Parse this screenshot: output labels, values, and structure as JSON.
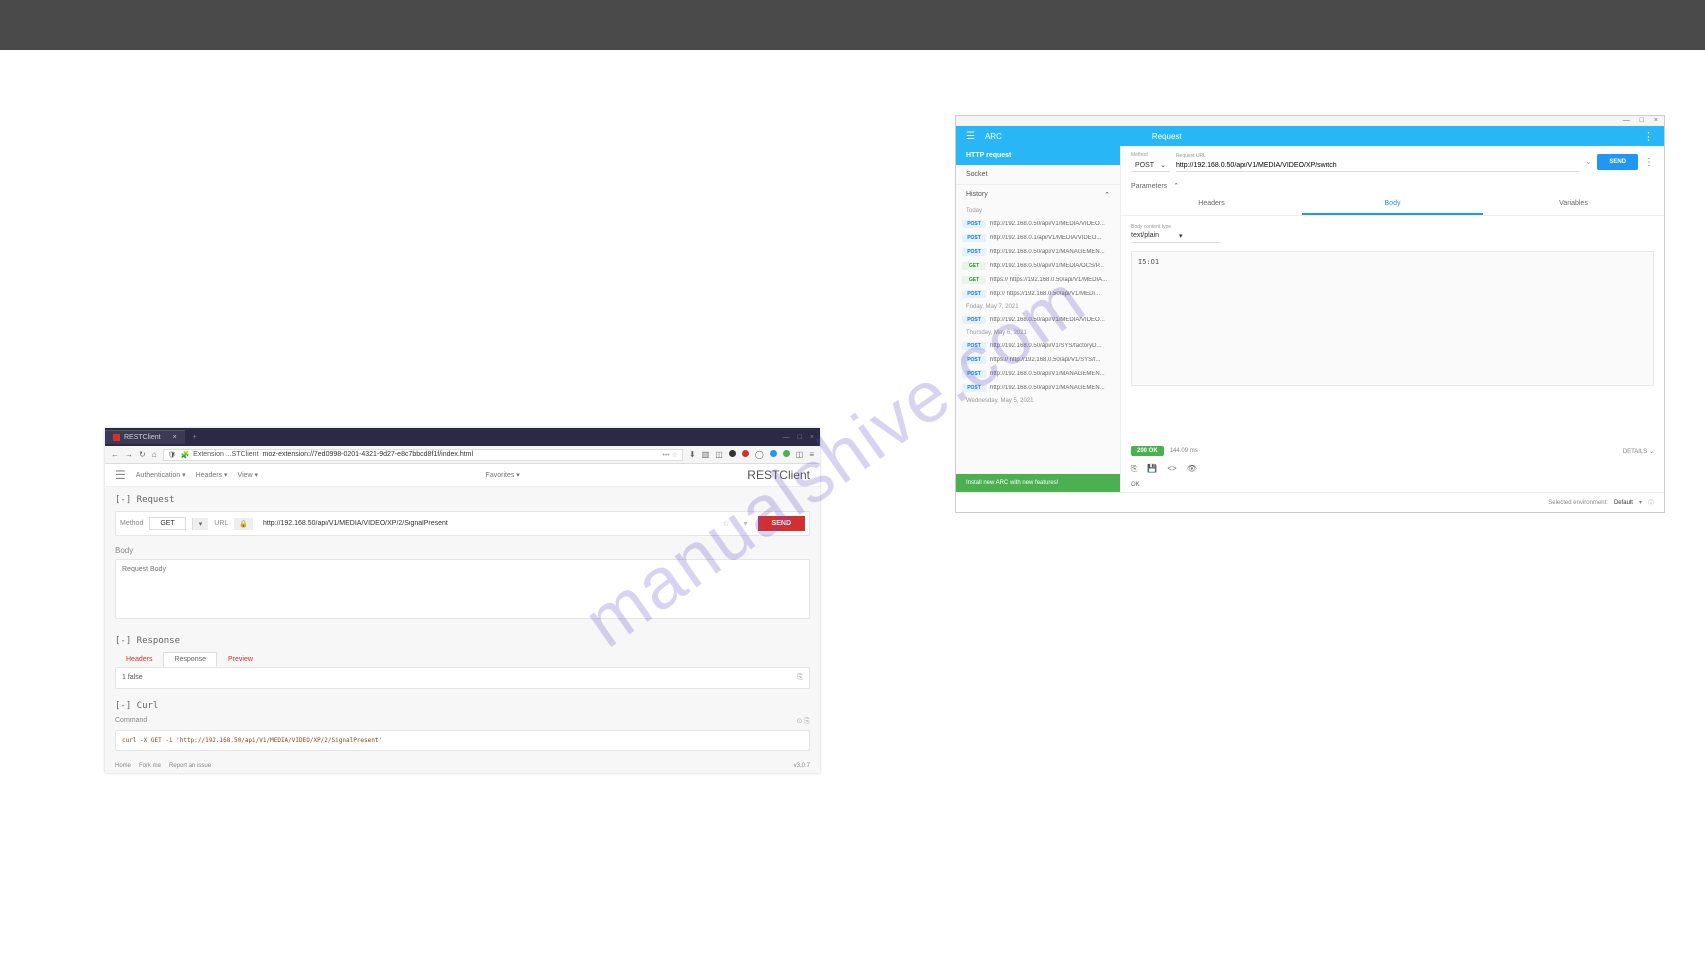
{
  "watermark": "manualshive.com",
  "left": {
    "browser_tab": "RESTClient",
    "browser_url": "moz-extension://7ed0998-0201-4321-9d27-e8c7bbcd8f1f/index.html",
    "url_prefix": "Extension ...STClient",
    "menu": {
      "authentication": "Authentication",
      "headers": "Headers",
      "view": "View"
    },
    "favorites": "Favorites",
    "brand": "RESTClient",
    "request": {
      "header": "[-] Request",
      "method_label": "Method",
      "method": "GET",
      "url_label": "URL",
      "url": "http://192.168.50/api/V1/MEDIA/VIDEO/XP/2/SignalPresent",
      "send": "SEND",
      "body_label": "Body",
      "body_placeholder": "Request Body"
    },
    "response": {
      "header": "[-] Response",
      "tabs": {
        "headers": "Headers",
        "response": "Response",
        "preview": "Preview"
      },
      "body": "1 false"
    },
    "curl": {
      "header": "[-] Curl",
      "command_label": "Command",
      "code": "curl -X GET -i 'http://192.168.50/api/V1/MEDIA/VIDEO/XP/2/SignalPresent'"
    },
    "footer": {
      "home": "Home",
      "fork": "Fork me",
      "report": "Report an issue",
      "version": "v3.0.7"
    }
  },
  "right": {
    "app_name": "ARC",
    "titlebar_request": "Request",
    "nav": {
      "http": "HTTP request",
      "socket": "Socket",
      "history": "History"
    },
    "history": {
      "today": "Today",
      "items_today": [
        {
          "method": "POST",
          "url": "http://192.168.0.50/api/V1/MEDIA/VIDEO..."
        },
        {
          "method": "POST",
          "url": "http://192.168.0.1/api/V1/MEDIA/VIDEO..."
        },
        {
          "method": "POST",
          "url": "http://192.168.0.50/api/V1/MANAGEMEN..."
        },
        {
          "method": "GET",
          "url": "http://192.168.0.50/api/V1/MEDIA/OCS/P..."
        },
        {
          "method": "GET",
          "url": "https:// https://192.168.0.50/api/V1/MEDIA..."
        },
        {
          "method": "POST",
          "url": "http:// https://192.168.0.50/api/V1/MEDI..."
        }
      ],
      "friday": "Friday, May 7, 2021",
      "items_friday": [
        {
          "method": "POST",
          "url": "http://192.168.0.50/api/V1/MEDIA/VIDEO..."
        }
      ],
      "thursday": "Thursday, May 6, 2021",
      "items_thursday": [
        {
          "method": "POST",
          "url": "http://192.168.0.50/api/V1/SYS/factoryD..."
        },
        {
          "method": "POST",
          "url": "https:// http://192.168.0.50/api/V1/SYS/f..."
        },
        {
          "method": "POST",
          "url": "http://192.168.0.50/api/V1/MANAGEMEN..."
        },
        {
          "method": "POST",
          "url": "http://192.168.0.50/api/V1/MANAGEMEN..."
        }
      ],
      "wednesday": "Wednesday, May 5, 2021"
    },
    "install_banner": "Install new ARC with new features!",
    "request": {
      "method_label": "Method",
      "method": "POST",
      "url_label": "Request URL",
      "url": "http://192.168.0.50/api/V1/MEDIA/VIDEO/XP/switch",
      "send": "SEND",
      "parameters": "Parameters"
    },
    "tabs": {
      "headers": "Headers",
      "body": "Body",
      "variables": "Variables"
    },
    "body": {
      "content_type_label": "Body content type",
      "content_type": "text/plain",
      "content": "I5:O1"
    },
    "response": {
      "status": "200 OK",
      "timing": "144.09 ms",
      "details": "DETAILS ⌄",
      "text": "OK"
    },
    "footer": {
      "env_label": "Selected environment:",
      "env_value": "Default"
    }
  }
}
